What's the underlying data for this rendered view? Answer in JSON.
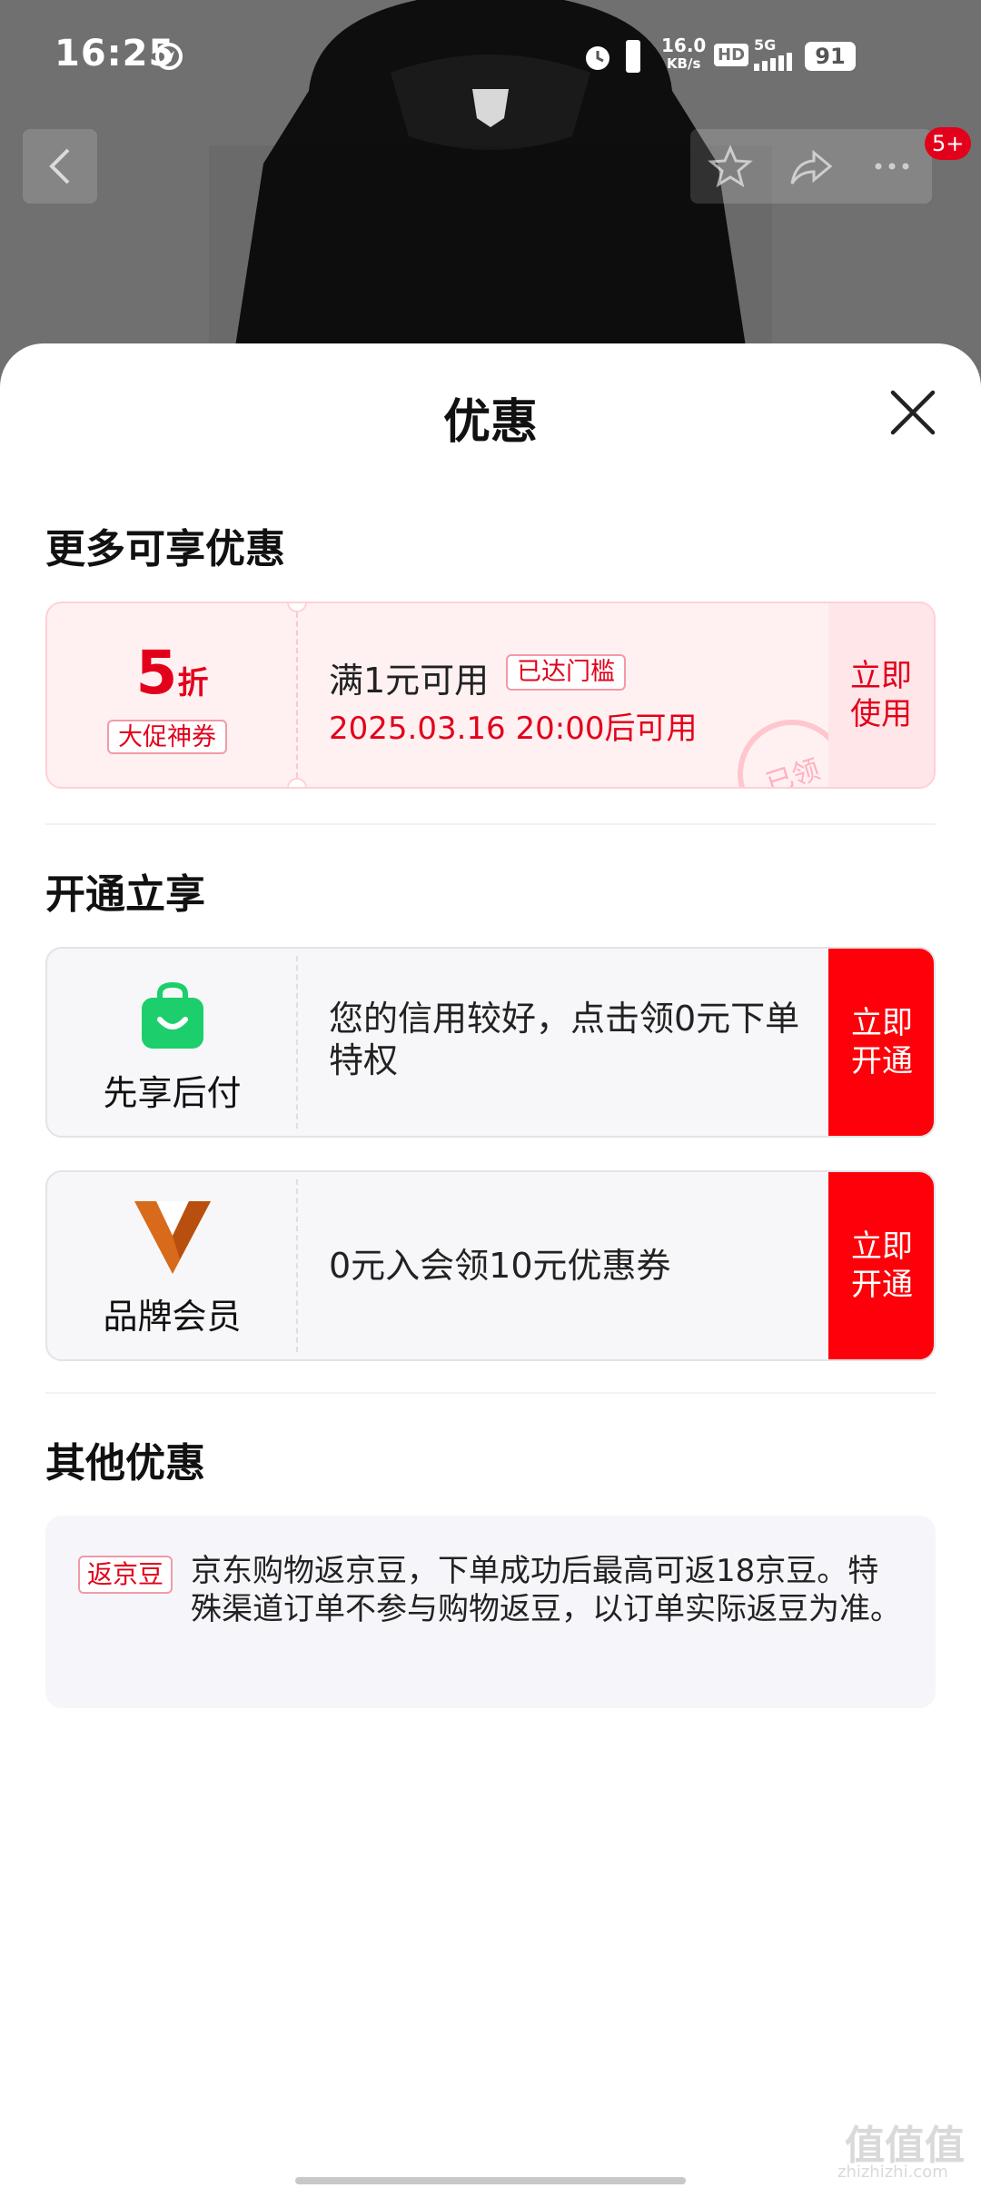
{
  "status": {
    "time": "16:25",
    "net_speed_top": "16.0",
    "net_speed_unit": "KB/s",
    "hd": "HD",
    "network": "5G",
    "battery": "91"
  },
  "nav": {
    "badge": "5+"
  },
  "sheet": {
    "title": "优惠"
  },
  "more_offers": {
    "title": "更多可享优惠",
    "coupon": {
      "discount_number": "5",
      "discount_unit": "折",
      "type_label": "大促神券",
      "condition": "满1元可用",
      "threshold_badge": "已达门槛",
      "valid_time": "2025.03.16 20:00后可用",
      "stamp_text": "已领",
      "button_line1": "立即",
      "button_line2": "使用"
    }
  },
  "activate": {
    "title": "开通立享",
    "cards": [
      {
        "name": "先享后付",
        "text": "您的信用较好，点击领0元下单特权",
        "button_line1": "立即",
        "button_line2": "开通",
        "icon": "shopping-bag-icon"
      },
      {
        "name": "品牌会员",
        "text": "0元入会领10元优惠券",
        "button_line1": "立即",
        "button_line2": "开通",
        "icon": "brand-member-v-icon"
      }
    ]
  },
  "other": {
    "title": "其他优惠",
    "tag": "返京豆",
    "text": "京东购物返京豆，下单成功后最高可返18京豆。特殊渠道订单不参与购物返豆，以订单实际返豆为准。"
  },
  "watermark": {
    "main": "值值值",
    "sub": "zhizhizhi.com"
  },
  "colors": {
    "accent": "#e3001b",
    "button_red": "#fe0009",
    "coupon_bg": "#fff1f2",
    "bag_green": "#1ccf6c",
    "v_orange": "#d86a1b"
  }
}
